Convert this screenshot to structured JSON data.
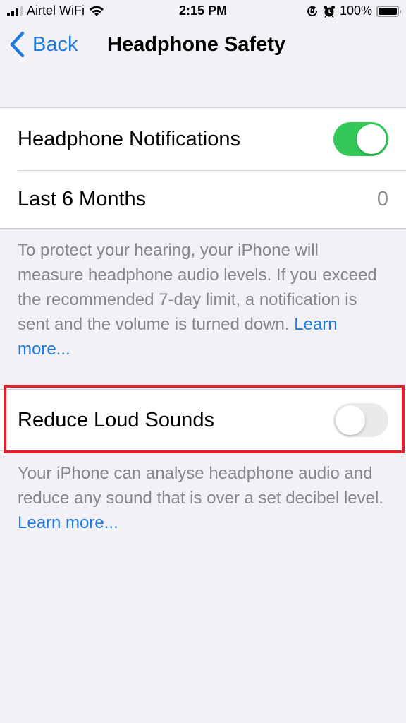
{
  "status_bar": {
    "carrier": "Airtel WiFi",
    "time": "2:15 PM",
    "battery_percent": "100%",
    "signal_bars_filled": 3,
    "signal_bars_total": 4,
    "icons": [
      "signal-icon",
      "wifi-icon",
      "orientation-lock-icon",
      "alarm-icon",
      "battery-icon"
    ]
  },
  "nav": {
    "back_label": "Back",
    "title": "Headphone Safety"
  },
  "groups": [
    {
      "rows": [
        {
          "label": "Headphone Notifications",
          "type": "toggle",
          "on": true
        },
        {
          "label": "Last 6 Months",
          "type": "value",
          "value": "0"
        }
      ],
      "footer": {
        "text": "To protect your hearing, your iPhone will measure headphone audio levels. If you exceed the recommended 7-day limit, a notification is sent and the volume is turned down. ",
        "link": "Learn more..."
      }
    },
    {
      "rows": [
        {
          "label": "Reduce Loud Sounds",
          "type": "toggle",
          "on": false
        }
      ],
      "footer": {
        "text": "Your iPhone can analyse headphone audio and reduce any sound that is over a set decibel level. ",
        "link": "Learn more..."
      }
    }
  ],
  "colors": {
    "accent": "#1f7ae0",
    "toggle_on": "#34c759",
    "toggle_off": "#e9e9eb",
    "highlight": "#e0202a",
    "background": "#f2f1f6"
  }
}
